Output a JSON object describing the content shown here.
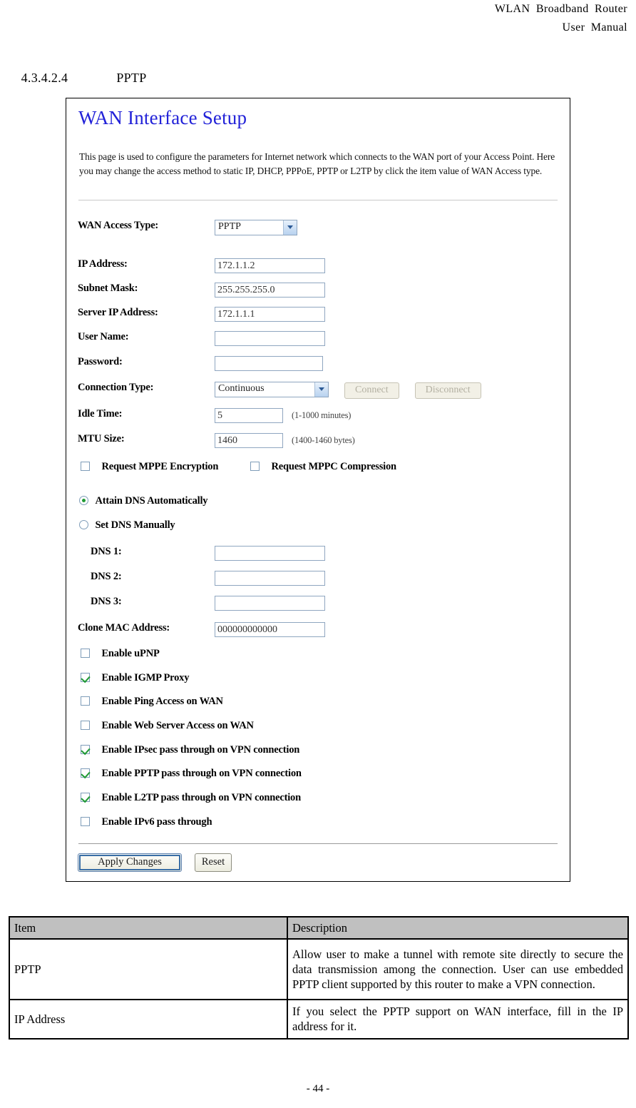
{
  "doc_header": {
    "line1": "WLAN  Broadband  Router",
    "line2": "User  Manual"
  },
  "section": {
    "number": "4.3.4.2.4",
    "title": "PPTP"
  },
  "screenshot": {
    "title": "WAN Interface Setup",
    "description": "This page is used to configure the parameters for Internet network which connects to the WAN port of your Access Point. Here you may change the access method to static IP, DHCP, PPPoE, PPTP or L2TP by click the item value of WAN Access type.",
    "fields": {
      "wan_access_type": {
        "label": "WAN Access Type:",
        "value": "PPTP"
      },
      "ip_address": {
        "label": "IP Address:",
        "value": "172.1.1.2"
      },
      "subnet_mask": {
        "label": "Subnet Mask:",
        "value": "255.255.255.0"
      },
      "server_ip_address": {
        "label": "Server IP Address:",
        "value": "172.1.1.1"
      },
      "user_name": {
        "label": "User Name:",
        "value": ""
      },
      "password": {
        "label": "Password:",
        "value": ""
      },
      "connection_type": {
        "label": "Connection Type:",
        "value": "Continuous"
      },
      "idle_time": {
        "label": "Idle Time:",
        "value": "5",
        "hint": "(1-1000 minutes)"
      },
      "mtu_size": {
        "label": "MTU Size:",
        "value": "1460",
        "hint": "(1400-1460 bytes)"
      },
      "dns1": {
        "label": "DNS 1:",
        "value": ""
      },
      "dns2": {
        "label": "DNS 2:",
        "value": ""
      },
      "dns3": {
        "label": "DNS 3:",
        "value": ""
      },
      "clone_mac": {
        "label": "Clone MAC Address:",
        "value": "000000000000"
      }
    },
    "buttons": {
      "connect": "Connect",
      "disconnect": "Disconnect",
      "apply_changes": "Apply Changes",
      "reset": "Reset"
    },
    "mppe_row": {
      "mppe_label": "Request MPPE Encryption",
      "mppe_checked": false,
      "mppc_label": "Request MPPC Compression",
      "mppc_checked": false
    },
    "dns_mode": {
      "auto_label": "Attain DNS Automatically",
      "auto_selected": true,
      "manual_label": "Set DNS Manually",
      "manual_selected": false
    },
    "options": [
      {
        "label": "Enable uPNP",
        "checked": false
      },
      {
        "label": "Enable IGMP Proxy",
        "checked": true
      },
      {
        "label": "Enable Ping Access on WAN",
        "checked": false
      },
      {
        "label": "Enable Web Server Access on WAN",
        "checked": false
      },
      {
        "label": "Enable IPsec pass through on VPN connection",
        "checked": true
      },
      {
        "label": "Enable PPTP pass through on VPN connection",
        "checked": true
      },
      {
        "label": "Enable L2TP pass through on VPN connection",
        "checked": true
      },
      {
        "label": "Enable IPv6 pass through",
        "checked": false
      }
    ],
    "colors": {
      "title_blue": "#2222d8",
      "check_green": "#1f9a33",
      "input_border": "#8fa6c0"
    }
  },
  "desc_table": {
    "headers": [
      "Item",
      "Description"
    ],
    "rows": [
      {
        "item": "PPTP",
        "description": "Allow user to make a tunnel with remote site directly to secure the data transmission among the connection. User can use embedded PPTP client supported by this router to make a VPN connection."
      },
      {
        "item": "IP Address",
        "description": "If you select the PPTP support on WAN interface, fill in the IP address for it."
      }
    ]
  },
  "footer": {
    "page_number": "- 44 -"
  }
}
